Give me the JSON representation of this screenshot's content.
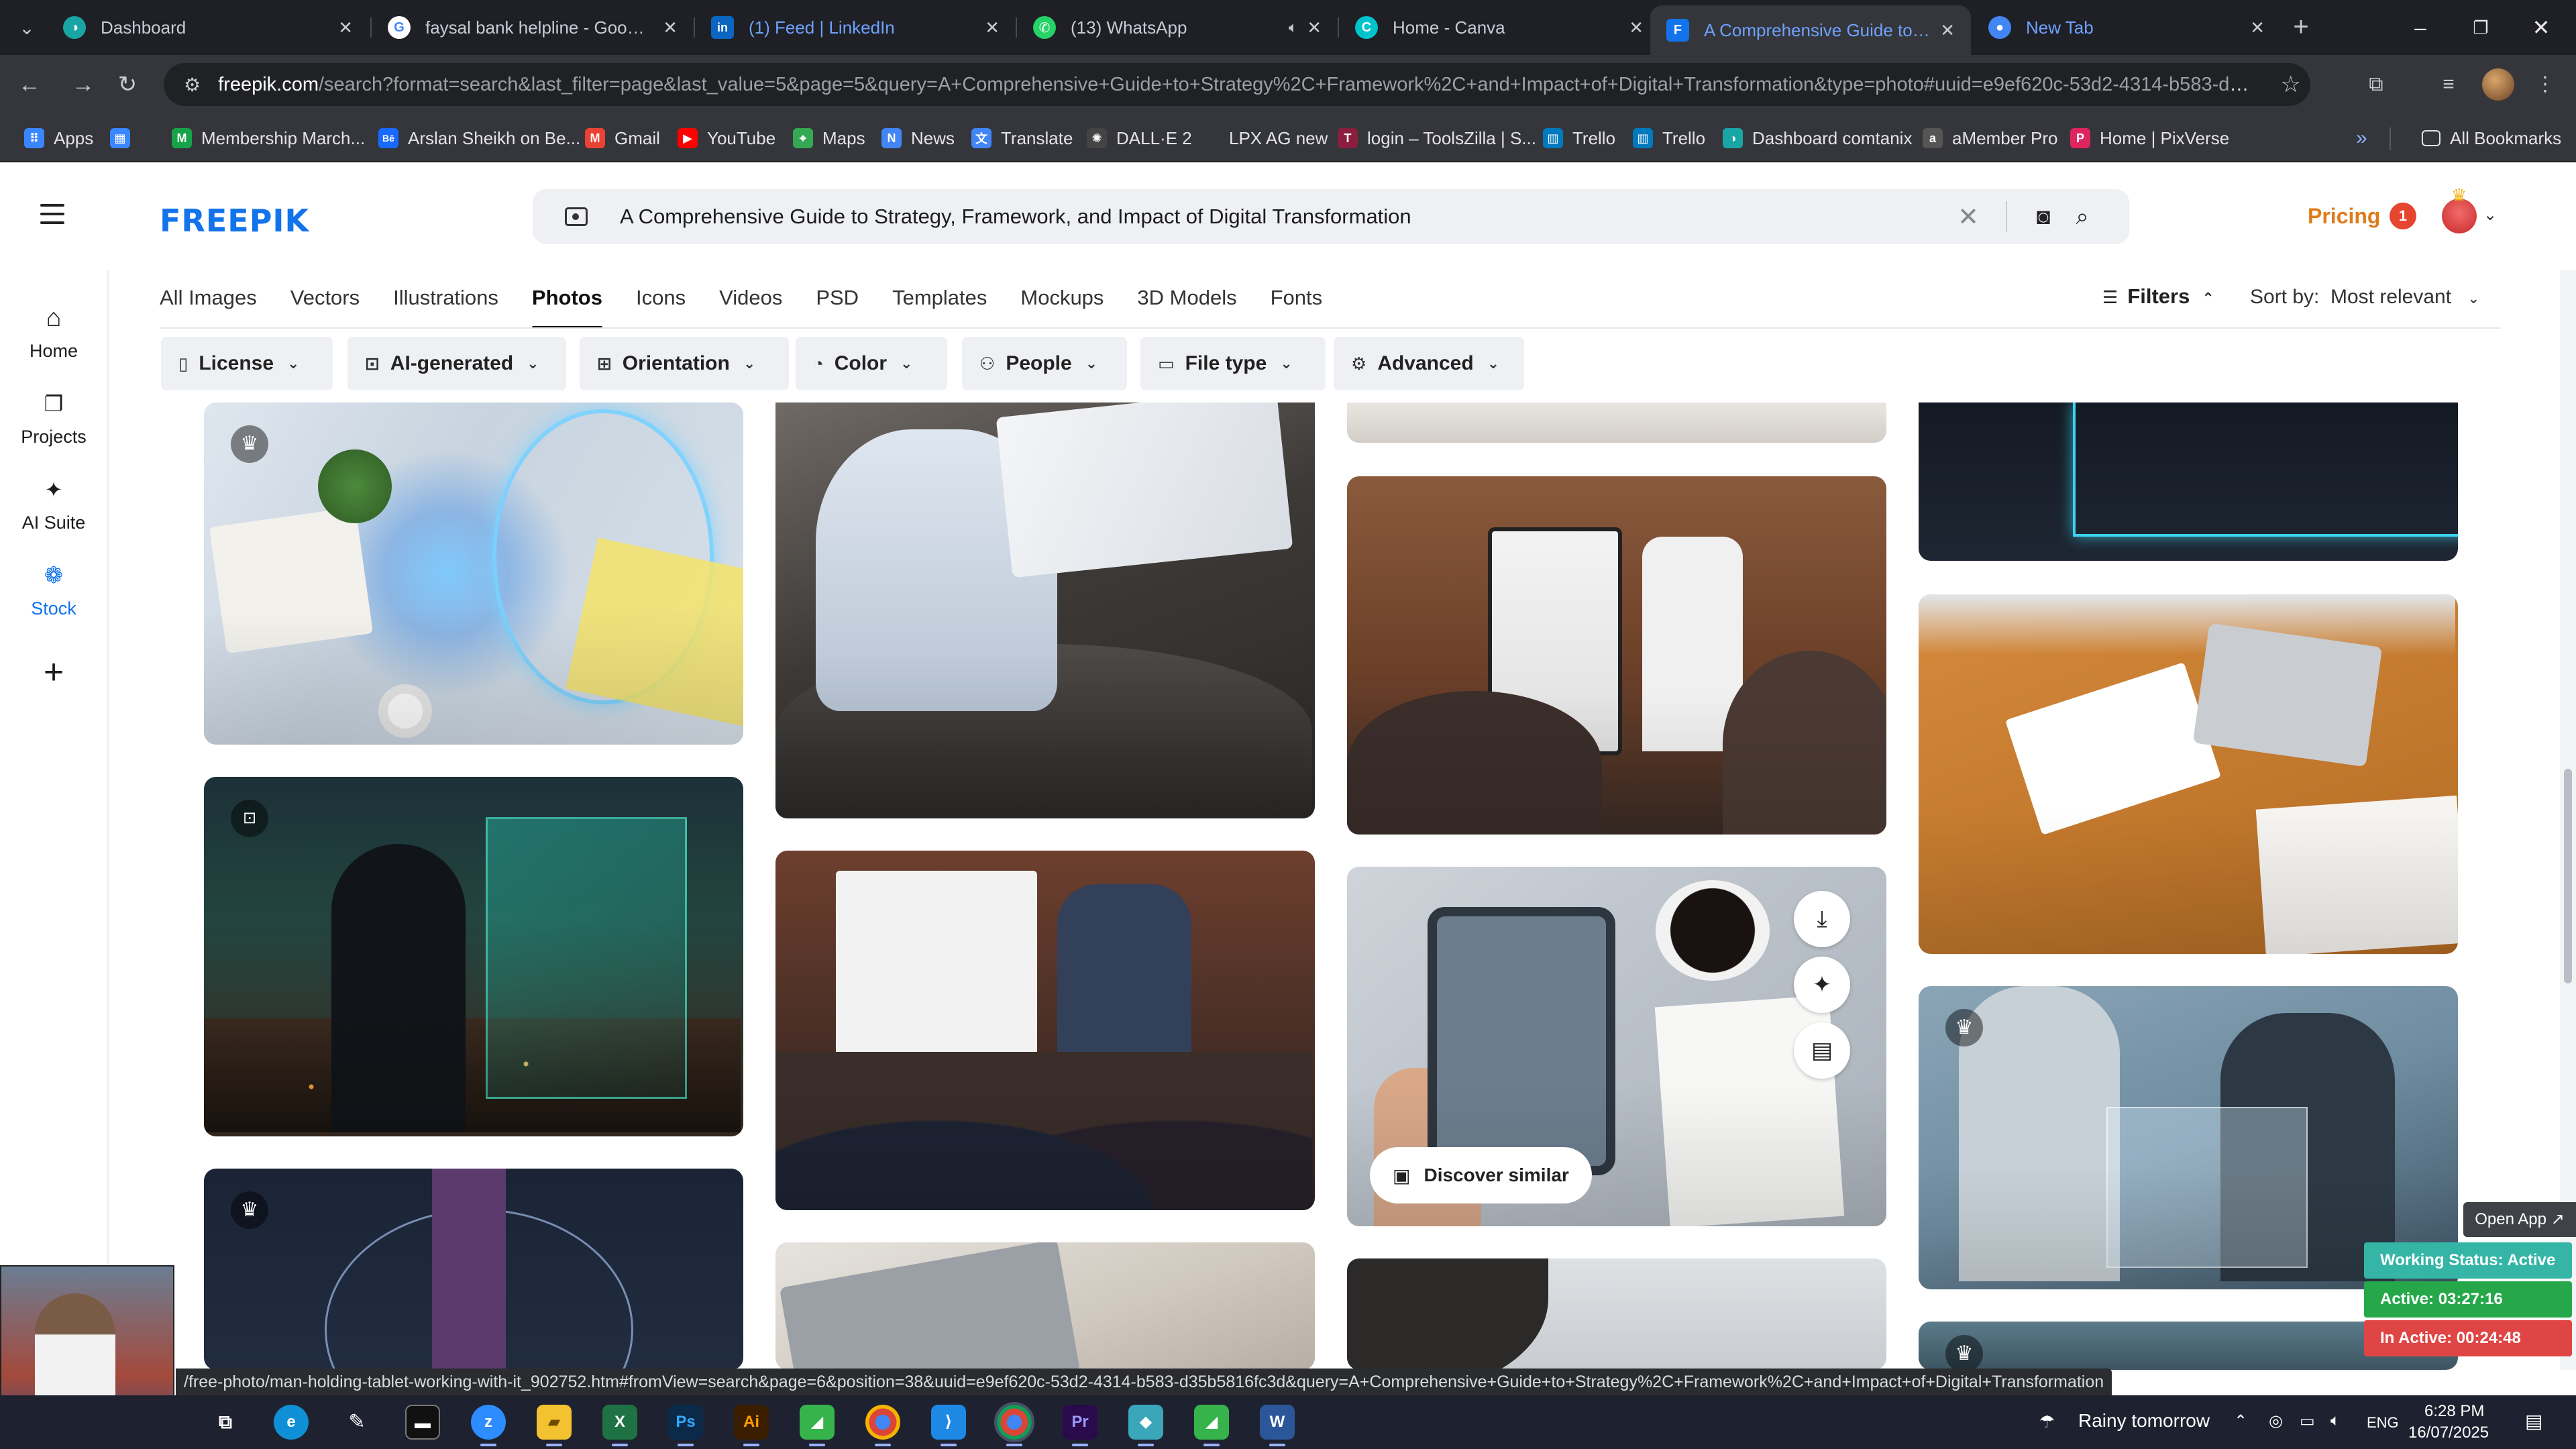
{
  "browser": {
    "tabs": [
      {
        "label": "Dashboard",
        "favicon": "dashboard-icon",
        "color": "#1aa5a5",
        "glyph": "◑",
        "active": false
      },
      {
        "label": "faysal bank helpline - Google S",
        "favicon": "google-icon",
        "color": "#ffffff",
        "glyph": "G",
        "active": false
      },
      {
        "label": "(1) Feed | LinkedIn",
        "favicon": "linkedin-icon",
        "color": "#0a66c2",
        "glyph": "in",
        "active": false
      },
      {
        "label": "(13) WhatsApp",
        "favicon": "whatsapp-icon",
        "color": "#25d366",
        "glyph": "✆",
        "active": false
      },
      {
        "label": "Home - Canva",
        "favicon": "canva-icon",
        "color": "#00c4cc",
        "glyph": "C",
        "active": false
      },
      {
        "label": "A Comprehensive Guide to Stra",
        "favicon": "freepik-icon",
        "color": "#1273eb",
        "glyph": "F",
        "active": true
      },
      {
        "label": "New Tab",
        "favicon": "chrome-icon",
        "color": "#4285f4",
        "glyph": "●",
        "active": false
      }
    ],
    "url_host": "freepik.com",
    "url_rest": "/search?format=search&last_filter=page&last_value=5&page=5&query=A+Comprehensive+Guide+to+Strategy%2C+Framework%2C+and+Impact+of+Digital+Transformation&type=photo#uuid=e9ef620c-53d2-4314-b583-d35b5816fc...",
    "bookmarks": [
      {
        "label": "Apps",
        "icon": "apps-grid-icon",
        "color": "#3a86ff",
        "glyph": "⠿"
      },
      {
        "label": "",
        "icon": "grid-icon",
        "color": "#3a86ff",
        "glyph": "▦"
      },
      {
        "label": "Membership March...",
        "icon": "membership-icon",
        "color": "#17a34a",
        "glyph": "M"
      },
      {
        "label": "Arslan Sheikh on Be...",
        "icon": "behance-icon",
        "color": "#1769ff",
        "glyph": "Bē"
      },
      {
        "label": "Gmail",
        "icon": "gmail-icon",
        "color": "#ea4335",
        "glyph": "M"
      },
      {
        "label": "YouTube",
        "icon": "youtube-icon",
        "color": "#ff0000",
        "glyph": "▶"
      },
      {
        "label": "Maps",
        "icon": "maps-icon",
        "color": "#34a853",
        "glyph": "⌖"
      },
      {
        "label": "News",
        "icon": "news-icon",
        "color": "#4285f4",
        "glyph": "N"
      },
      {
        "label": "Translate",
        "icon": "translate-icon",
        "color": "#4285f4",
        "glyph": "文"
      },
      {
        "label": "DALL·E 2",
        "icon": "openai-icon",
        "color": "#444444",
        "glyph": "✺"
      },
      {
        "label": "LPX AG new",
        "icon": "blank-page-icon",
        "color": "#35363b",
        "glyph": ""
      },
      {
        "label": "login – ToolsZilla | S...",
        "icon": "toolszilla-icon",
        "color": "#8b1e3f",
        "glyph": "T"
      },
      {
        "label": "Trello",
        "icon": "trello-icon",
        "color": "#0079bf",
        "glyph": "▥"
      },
      {
        "label": "Trello",
        "icon": "trello-icon",
        "color": "#0079bf",
        "glyph": "▥"
      },
      {
        "label": "Dashboard comtanix",
        "icon": "dashboard-icon",
        "color": "#1aa5a5",
        "glyph": "◑"
      },
      {
        "label": "aMember Pro",
        "icon": "amember-icon",
        "color": "#555555",
        "glyph": "a"
      },
      {
        "label": "Home | PixVerse",
        "icon": "pixverse-icon",
        "color": "#e0245e",
        "glyph": "P"
      }
    ],
    "more_bookmarks": "»",
    "all_bookmarks": "All Bookmarks"
  },
  "freepik": {
    "logo": "FREEPIK",
    "search_query": "A Comprehensive Guide to Strategy, Framework, and Impact of Digital Transformation",
    "pricing": "Pricing",
    "notification_count": "1",
    "left_rail": [
      {
        "label": "Home",
        "icon": "home-icon",
        "glyph": "⌂"
      },
      {
        "label": "Projects",
        "icon": "projects-icon",
        "glyph": "❐"
      },
      {
        "label": "AI Suite",
        "icon": "ai-suite-icon",
        "glyph": "✦"
      },
      {
        "label": "Stock",
        "icon": "stock-icon",
        "glyph": "❁"
      },
      {
        "label": "",
        "icon": "add-icon",
        "glyph": "+"
      }
    ],
    "category_tabs": [
      "All Images",
      "Vectors",
      "Illustrations",
      "Photos",
      "Icons",
      "Videos",
      "PSD",
      "Templates",
      "Mockups",
      "3D Models",
      "Fonts"
    ],
    "active_tab": "Photos",
    "filters_label": "Filters",
    "sort_label": "Sort by:",
    "sort_value": "Most relevant",
    "filter_chips": [
      {
        "label": "License",
        "icon": "license-icon",
        "glyph": "▯"
      },
      {
        "label": "AI-generated",
        "icon": "ai-generated-icon",
        "glyph": "⊡"
      },
      {
        "label": "Orientation",
        "icon": "orientation-icon",
        "glyph": "⊞"
      },
      {
        "label": "Color",
        "icon": "palette-icon",
        "glyph": "◔"
      },
      {
        "label": "People",
        "icon": "people-icon",
        "glyph": "⚇"
      },
      {
        "label": "File type",
        "icon": "file-icon",
        "glyph": "▭"
      },
      {
        "label": "Advanced",
        "icon": "settings-icon",
        "glyph": "⚙"
      }
    ],
    "discover_similar": "Discover similar",
    "hovered_link": "/free-photo/man-holding-tablet-working-with-it_902752.htm#fromView=search&page=6&position=38&uuid=e9ef620c-53d2-4314-b583-d35b5816fc3d&query=A+Comprehensive+Guide+to+Strategy%2C+Framework%2C+and+Impact+of+Digital+Transformation"
  },
  "widgets": {
    "open_app": "Open App ↗",
    "working_status": "Working Status: Active",
    "active_time": "Active: 03:27:16",
    "inactive_time": "In Active: 00:24:48",
    "colors": {
      "working": "#34b5a6",
      "active": "#26a84a",
      "inactive": "#e04545"
    }
  },
  "taskbar": {
    "apps": [
      {
        "name": "task-view-icon",
        "glyph": "⧉",
        "color": "transparent"
      },
      {
        "name": "edge-icon",
        "glyph": "e",
        "color": "#0f8fd6"
      },
      {
        "name": "pen-tool-icon",
        "glyph": "✎",
        "color": "transparent"
      },
      {
        "name": "terminal-icon",
        "glyph": "▬",
        "color": "#111111"
      },
      {
        "name": "zoom-icon",
        "glyph": "z",
        "color": "#2d8cff"
      },
      {
        "name": "file-explorer-icon",
        "glyph": "▰",
        "color": "#f2c230"
      },
      {
        "name": "excel-icon",
        "glyph": "X",
        "color": "#1f7244"
      },
      {
        "name": "photoshop-icon",
        "glyph": "Ps",
        "color": "#0b2a4a"
      },
      {
        "name": "illustrator-icon",
        "glyph": "Ai",
        "color": "#3b1e00"
      },
      {
        "name": "green-app-icon",
        "glyph": "◢",
        "color": "#36b34a"
      },
      {
        "name": "chrome-icon",
        "glyph": "◉",
        "color": "#db4437"
      },
      {
        "name": "vscode-icon",
        "glyph": "⟩",
        "color": "#1e88e5"
      },
      {
        "name": "chrome-active-icon",
        "glyph": "◉",
        "color": "#db4437"
      },
      {
        "name": "premiere-icon",
        "glyph": "Pr",
        "color": "#2a0a4a"
      },
      {
        "name": "cube-app-icon",
        "glyph": "◆",
        "color": "#3aa6b9"
      },
      {
        "name": "green-app-2-icon",
        "glyph": "◢",
        "color": "#36b34a"
      },
      {
        "name": "word-icon",
        "glyph": "W",
        "color": "#2b579a"
      }
    ],
    "weather": "Rainy tomorrow",
    "language": "ENG",
    "time": "6:28 PM",
    "date": "16/07/2025"
  }
}
